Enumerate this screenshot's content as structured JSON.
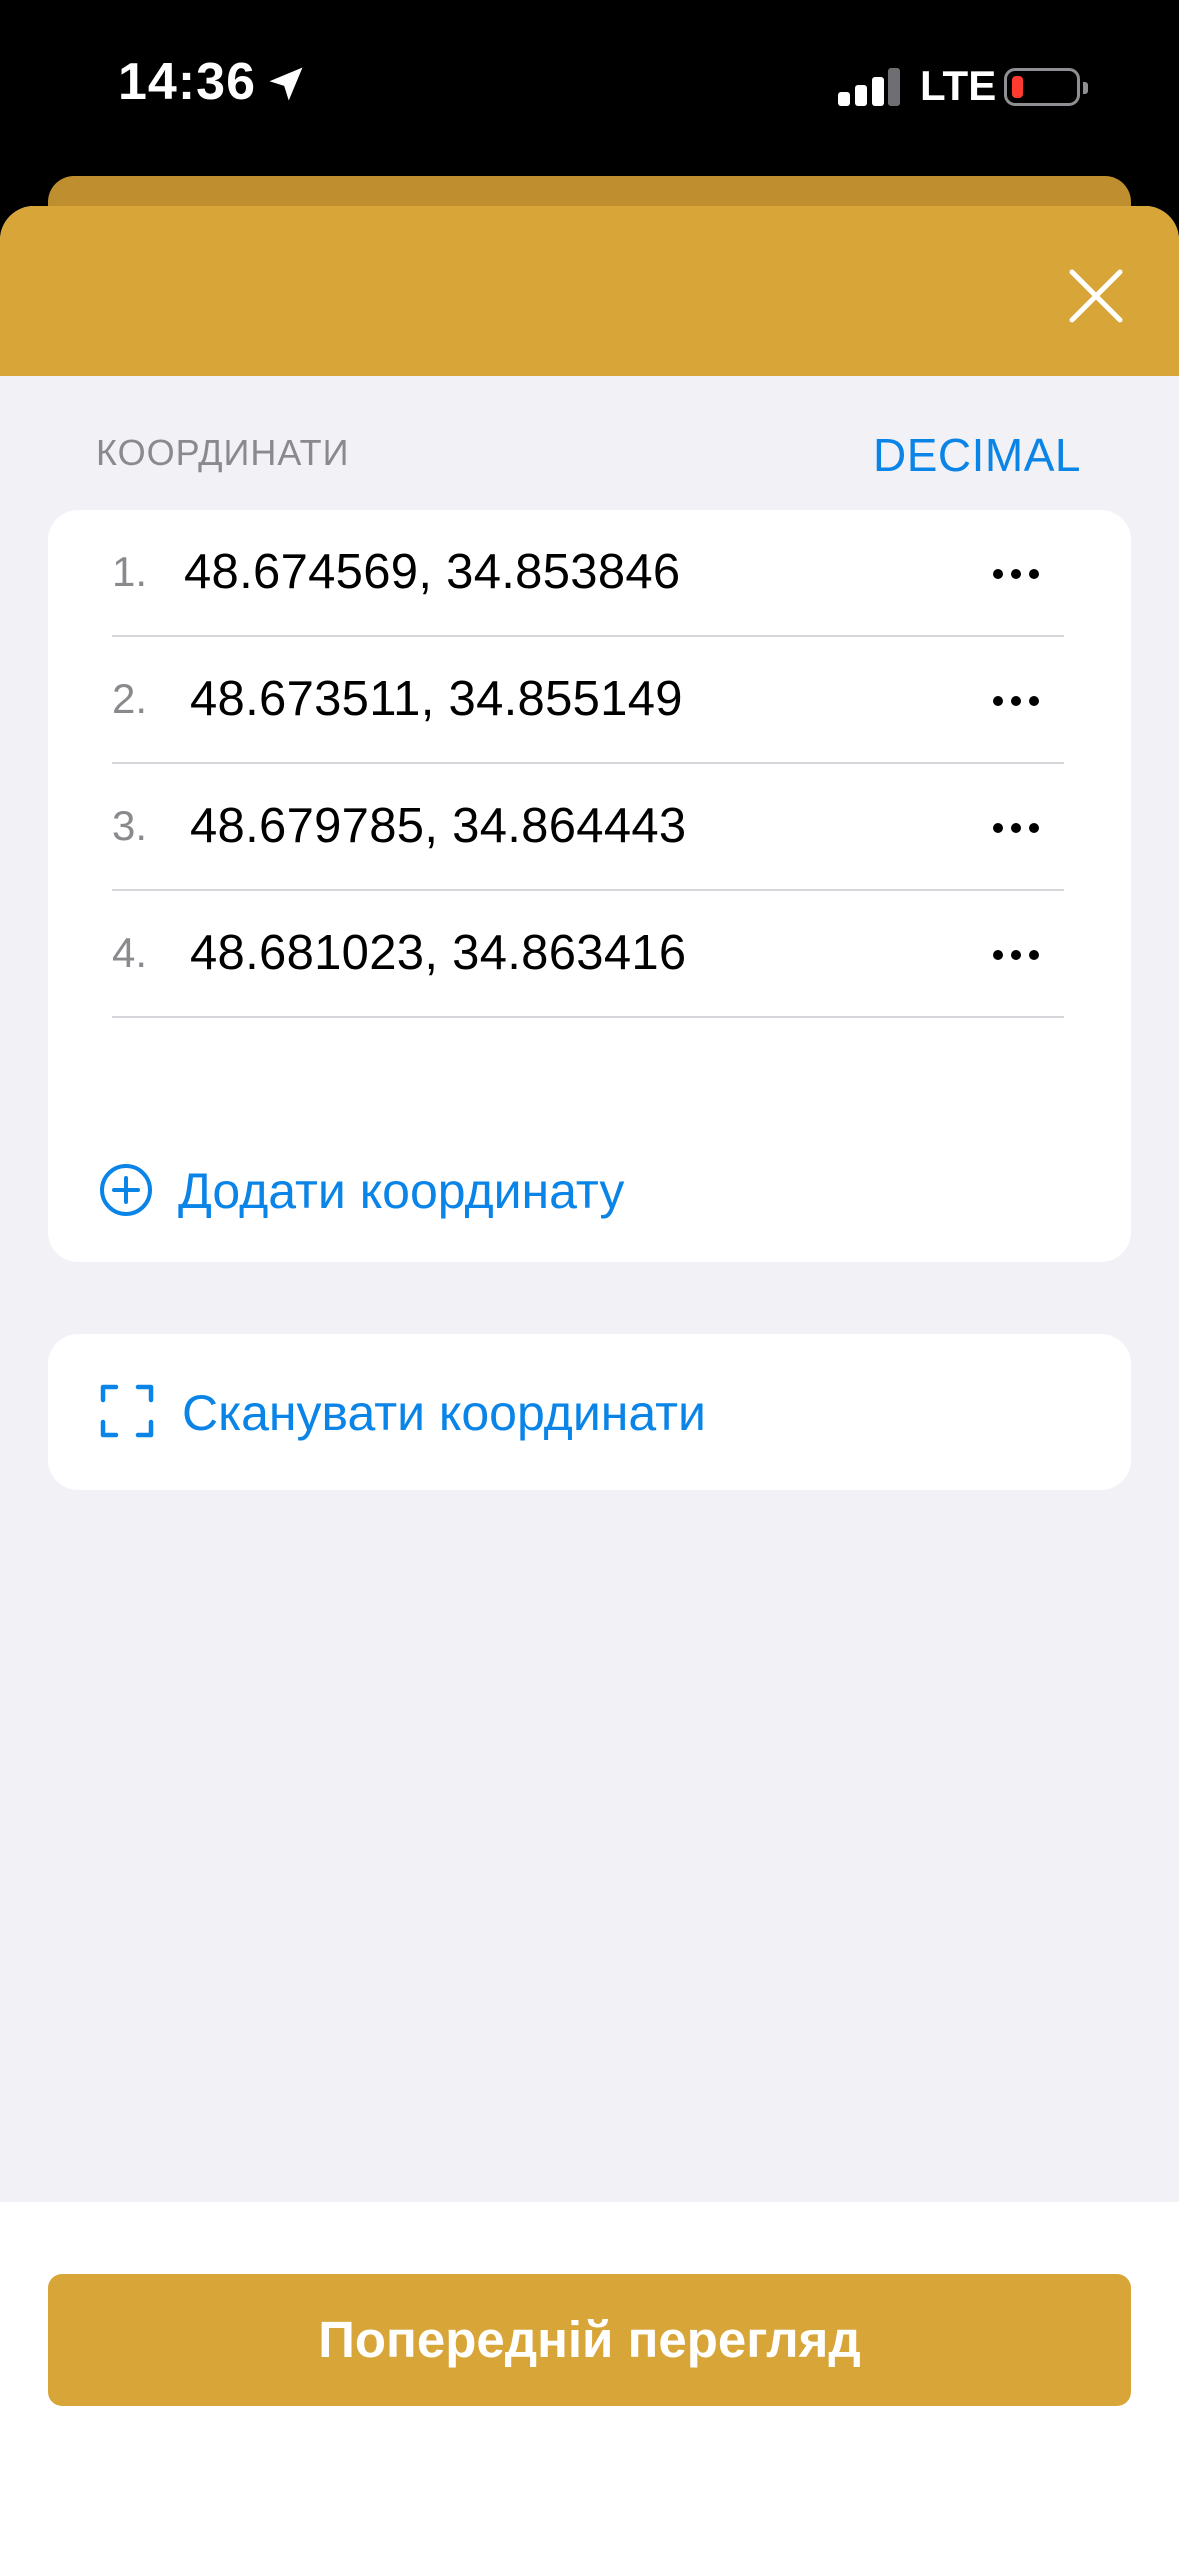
{
  "status_bar": {
    "time": "14:36",
    "network": "LTE",
    "icons": [
      "location-arrow-icon",
      "signal-icon",
      "battery-icon"
    ],
    "battery_color": "#ff3b30"
  },
  "header": {
    "close_icon": "close-icon",
    "accent_color": "#d8a539"
  },
  "coordinates_section": {
    "title": "КООРДИНАТИ",
    "format_label": "DECIMAL",
    "items": [
      {
        "index": "1.",
        "value": "48.674569, 34.853846"
      },
      {
        "index": "2.",
        "value": "48.673511, 34.855149"
      },
      {
        "index": "3.",
        "value": "48.679785, 34.864443"
      },
      {
        "index": "4.",
        "value": "48.681023, 34.863416"
      }
    ],
    "more_icon": "more-horizontal-icon",
    "add_label": "Додати координату",
    "add_icon": "plus-circle-icon"
  },
  "scan": {
    "label": "Сканувати координати",
    "icon": "scan-icon"
  },
  "footer": {
    "preview_label": "Попередній перегляд"
  },
  "colors": {
    "link": "#0a84e6",
    "background": "#f1f1f6"
  }
}
